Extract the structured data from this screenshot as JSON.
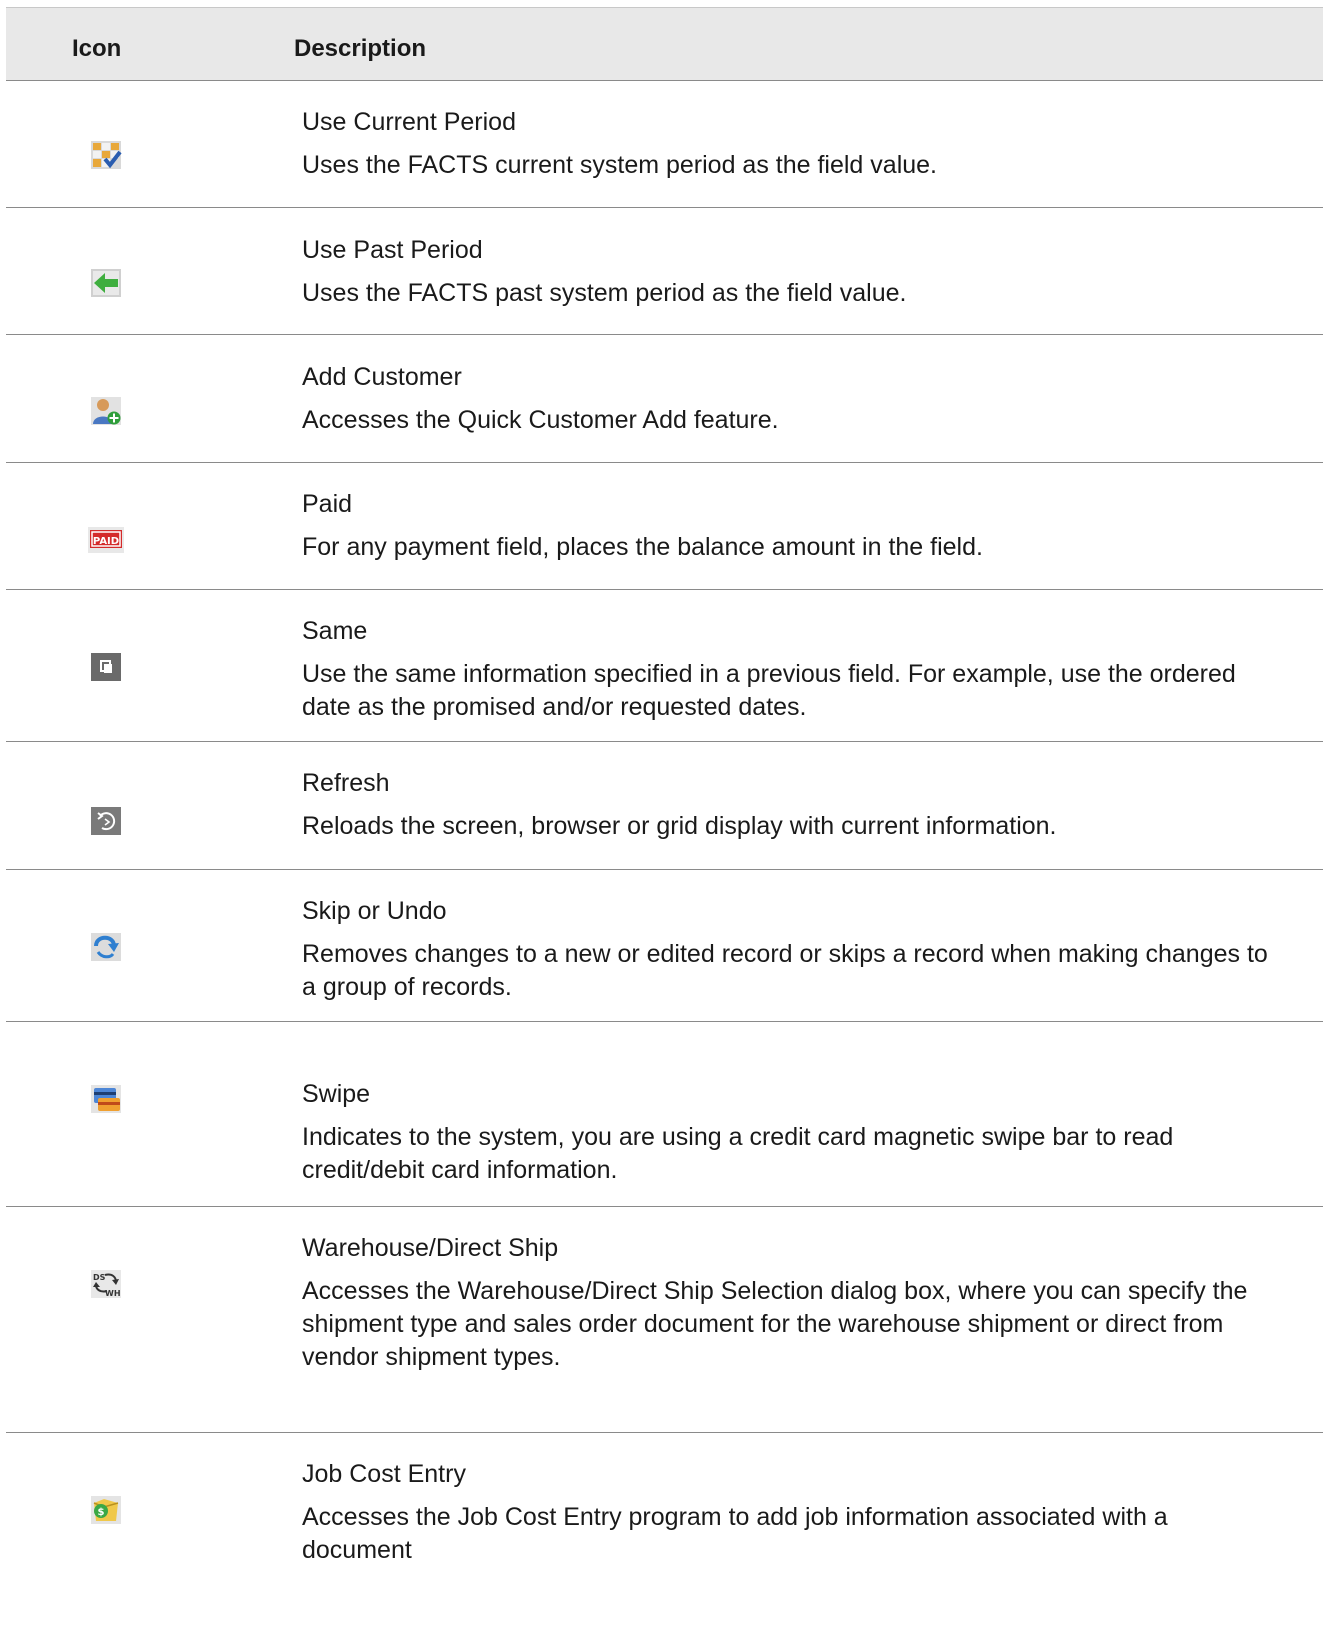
{
  "header": {
    "col_icon": "Icon",
    "col_description": "Description"
  },
  "rows": [
    {
      "name": "Use Current Period",
      "text": "Uses the FACTS current system period as the field value.",
      "icon": "calendar-check-icon"
    },
    {
      "name": "Use Past Period",
      "text": "Uses the FACTS past system period as the field value.",
      "icon": "calendar-back-arrow-icon"
    },
    {
      "name": "Add Customer",
      "text": "Accesses the Quick Customer Add feature.",
      "icon": "add-user-icon"
    },
    {
      "name": "Paid",
      "text": "For any payment field, places the balance amount in the field.",
      "icon": "paid-stamp-icon"
    },
    {
      "name": "Same",
      "text": "Use the same information specified in a previous field. For example, use the ordered date as the promised and/or requested dates.",
      "icon": "copy-icon"
    },
    {
      "name": "Refresh",
      "text": "Reloads the screen, browser or grid display with current information.",
      "icon": "refresh-icon"
    },
    {
      "name": "Skip or Undo",
      "text": "Removes changes to a new or edited record or skips a record when making changes to a group of records.",
      "icon": "skip-arrow-icon"
    },
    {
      "name": "Swipe",
      "text": "Indicates to the system, you are using a credit card magnetic swipe bar to read credit/debit card information.",
      "icon": "card-swipe-icon"
    },
    {
      "name": "Warehouse/Direct Ship",
      "text": "Accesses the Warehouse/Direct Ship Selection dialog box, where you can specify the shipment type and sales order document for the warehouse shipment or direct from vendor shipment types.",
      "icon": "ds-wh-switch-icon"
    },
    {
      "name": "Job Cost Entry",
      "text": "Accesses the Job Cost Entry program to add job information associated with a document",
      "icon": "job-cost-icon"
    }
  ]
}
